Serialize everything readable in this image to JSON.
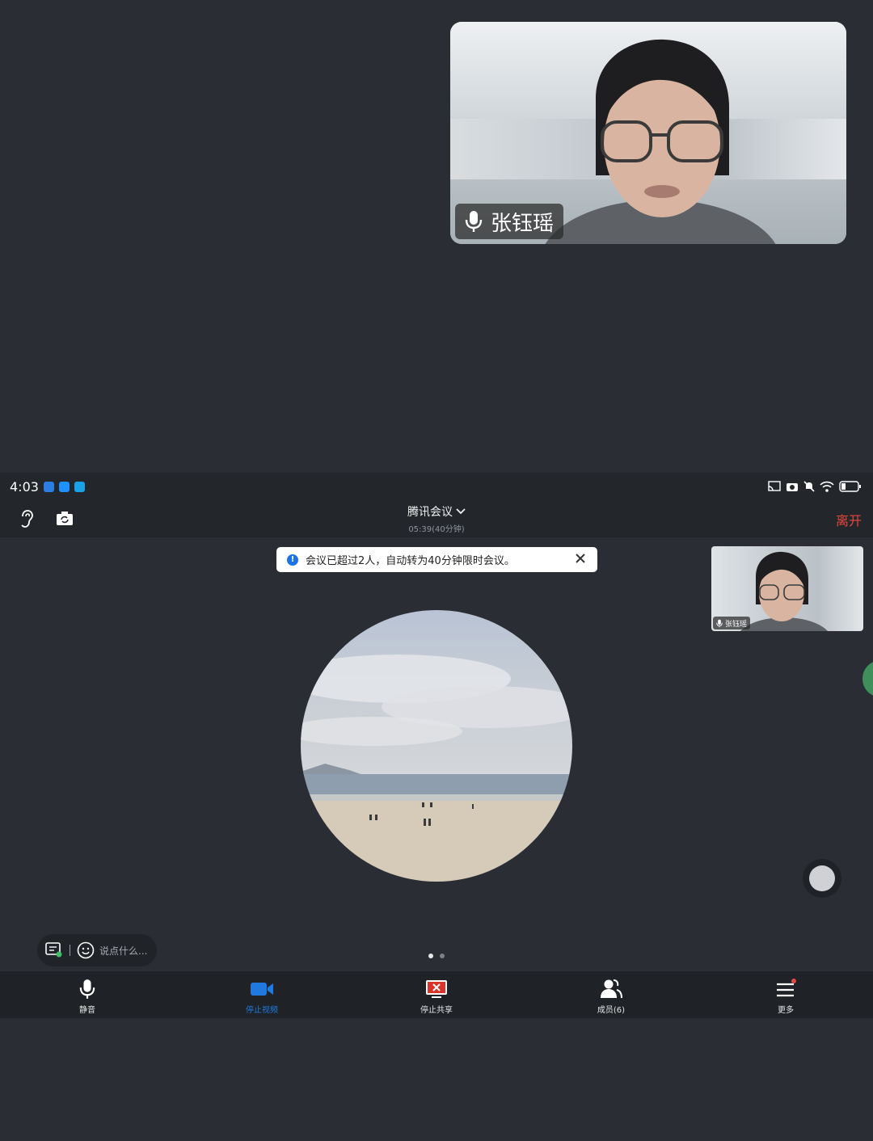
{
  "top_tile": {
    "participant_name": "张钰瑶"
  },
  "status_bar": {
    "time": "4:03"
  },
  "header": {
    "title": "腾讯会议",
    "duration": "05:39(40分钟)",
    "leave_label": "离开"
  },
  "notice": {
    "text": "会议已超过2人，自动转为40分钟限时会议。"
  },
  "small_tile": {
    "participant_name": "张钰瑶"
  },
  "chat": {
    "placeholder": "说点什么..."
  },
  "toolbar": {
    "mute_label": "静音",
    "video_label": "停止视频",
    "share_label": "停止共享",
    "members_label": "成员(6)",
    "more_label": "更多"
  },
  "colors": {
    "accent": "#1f7ae0",
    "leave": "#e5483d",
    "background": "#2a2d33"
  }
}
